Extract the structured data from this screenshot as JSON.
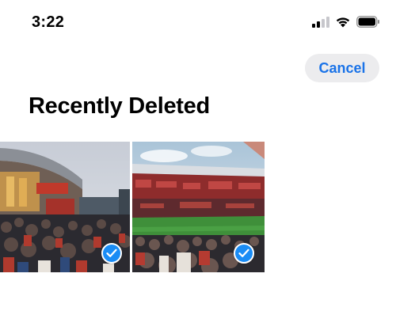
{
  "status_bar": {
    "time": "3:22",
    "icons": [
      "cellular-signal-icon",
      "wifi-icon",
      "battery-icon"
    ]
  },
  "header": {
    "cancel_label": "Cancel"
  },
  "album": {
    "title": "Recently Deleted",
    "photos": [
      {
        "subject": "stadium-exterior-crowd",
        "selected": true
      },
      {
        "subject": "stadium-interior-crowd",
        "selected": true
      }
    ]
  },
  "colors": {
    "accent": "#1a73e8",
    "check_badge": "#1a8cf5",
    "cancel_bg": "#ececee",
    "background": "#ffffff"
  }
}
